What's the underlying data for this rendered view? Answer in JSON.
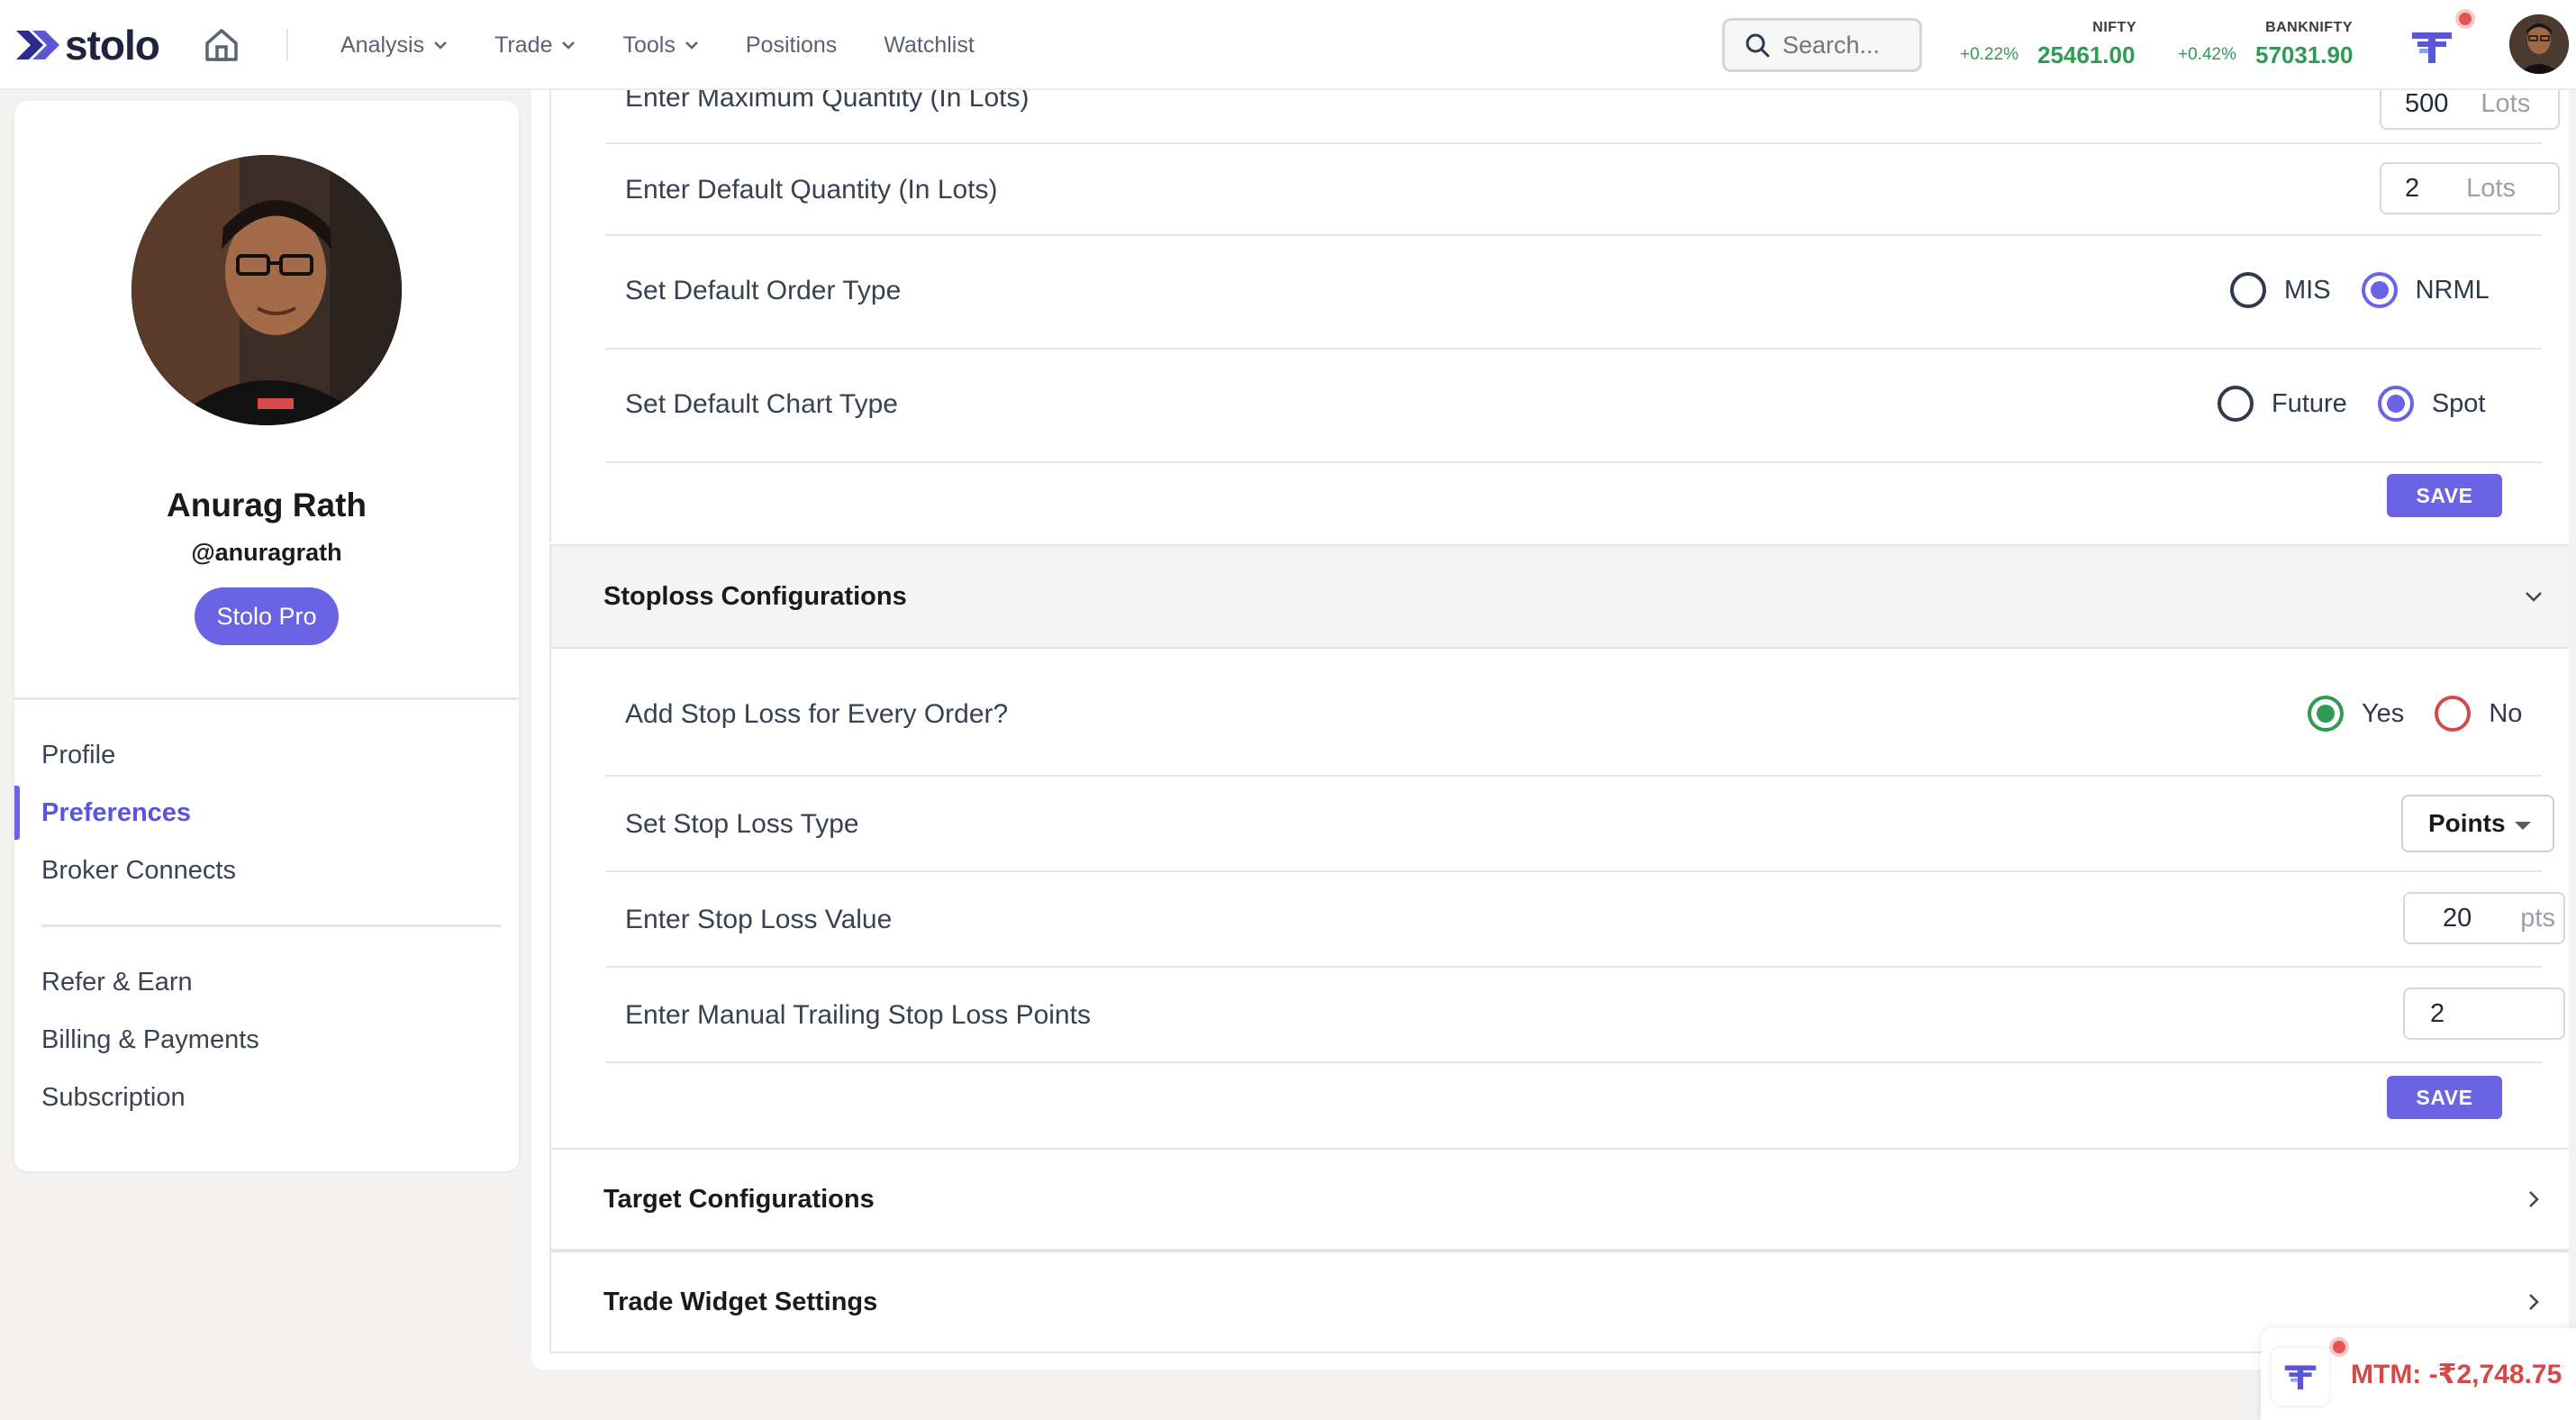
{
  "app": {
    "logo_text": "stolo"
  },
  "nav": {
    "items": [
      {
        "label": "Analysis",
        "dropdown": true
      },
      {
        "label": "Trade",
        "dropdown": true
      },
      {
        "label": "Tools",
        "dropdown": true
      },
      {
        "label": "Positions",
        "dropdown": false
      },
      {
        "label": "Watchlist",
        "dropdown": false
      }
    ],
    "search_placeholder": "Search..."
  },
  "tickers": [
    {
      "name": "NIFTY",
      "change": "+0.22%",
      "value": "25461.00"
    },
    {
      "name": "BANKNIFTY",
      "change": "+0.42%",
      "value": "57031.90"
    }
  ],
  "profile": {
    "name": "Anurag Rath",
    "handle": "@anuragrath",
    "badge": "Stolo Pro"
  },
  "sidebar": {
    "primary_links": [
      "Profile",
      "Preferences",
      "Broker Connects"
    ],
    "secondary_links": [
      "Refer & Earn",
      "Billing & Payments",
      "Subscription"
    ],
    "active": "Preferences"
  },
  "order_prefs": {
    "max_qty_label": "Enter Maximum Quantity (In Lots)",
    "max_qty_value": "500",
    "default_qty_label": "Enter Default Quantity (In Lots)",
    "default_qty_value": "2",
    "lots_unit": "Lots",
    "order_type_label": "Set Default Order Type",
    "order_type_options": [
      "MIS",
      "NRML"
    ],
    "order_type_selected": "NRML",
    "chart_type_label": "Set Default Chart Type",
    "chart_type_options": [
      "Future",
      "Spot"
    ],
    "chart_type_selected": "Spot",
    "save_label": "SAVE"
  },
  "stoploss": {
    "title": "Stoploss Configurations",
    "every_order_label": "Add Stop Loss for Every Order?",
    "every_order_options": [
      "Yes",
      "No"
    ],
    "every_order_selected": "Yes",
    "type_label": "Set Stop Loss Type",
    "type_value": "Points",
    "value_label": "Enter Stop Loss Value",
    "value": "20",
    "value_unit": "pts",
    "trailing_label": "Enter Manual Trailing Stop Loss Points",
    "trailing_value": "2",
    "save_label": "SAVE"
  },
  "sections": {
    "target": "Target Configurations",
    "trade_widget": "Trade Widget Settings"
  },
  "mtm": {
    "text": "MTM:  -₹2,748.75"
  },
  "colors": {
    "accent": "#6a64e5",
    "positive": "#2e9a52",
    "negative": "#d44848"
  }
}
